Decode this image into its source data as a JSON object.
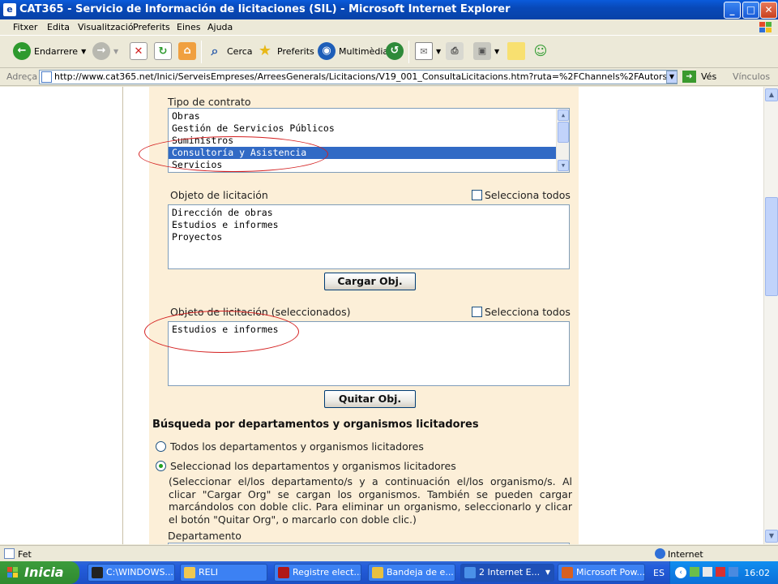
{
  "window": {
    "title": "CAT365 - Servicio de Información de licitaciones (SIL) - Microsoft Internet Explorer"
  },
  "menu": [
    "Fitxer",
    "Edita",
    "Visualització",
    "Preferits",
    "Eines",
    "Ajuda"
  ],
  "toolbar": {
    "back": "Endarrere",
    "search": "Cerca",
    "favorites": "Preferits",
    "media": "Multimèdia"
  },
  "address": {
    "label": "Adreça",
    "url": "http://www.cat365.net/Inici/ServeisEmpreses/ArreesGenerals/Licitacions/V19_001_ConsultaLicitacions.htm?ruta=%2FChannels%2FAutors%2FInici%2FServeisEmpres",
    "go": "Vés",
    "links": "Vínculos"
  },
  "form": {
    "contract_type_label": "Tipo de contrato",
    "contract_types": [
      {
        "label": "Obras",
        "selected": false
      },
      {
        "label": "Gestión de Servicios Públicos",
        "selected": false
      },
      {
        "label": "Suministros",
        "selected": false
      },
      {
        "label": "Consultoría y Asistencia",
        "selected": true
      },
      {
        "label": "Servicios",
        "selected": false
      }
    ],
    "object_label": "Objeto de licitación",
    "select_all": "Selecciona todos",
    "objects": [
      "Dirección de obras",
      "Estudios e informes",
      "Proyectos"
    ],
    "load_button": "Cargar Obj.",
    "selected_label": "Objeto de licitación (seleccionados)",
    "selected_objects": [
      "Estudios e informes"
    ],
    "remove_button": "Quitar Obj.",
    "section_title": "Búsqueda por departamentos y organismos licitadores",
    "radio_all": "Todos los departamentos y organismos licitadores",
    "radio_select": "Seleccionad los departamentos y organismos licitadores",
    "radio_selected": "select",
    "instructions": "(Seleccionar el/los departamento/s y a continuación el/los organismo/s. Al clicar \"Cargar Org\" se cargan los organismos. También se pueden cargar marcándolos con doble clic. Para eliminar un organismo, seleccionarlo y clicar el botón \"Quitar Org\", o marcarlo con doble clic.)",
    "department_label": "Departamento"
  },
  "status": {
    "left": "Fet",
    "zone": "Internet"
  },
  "taskbar": {
    "start": "Inicia",
    "tasks": [
      "C:\\WINDOWS...",
      "RELI",
      "Registre elect...",
      "Bandeja de e...",
      "2 Internet E...",
      "Microsoft Pow..."
    ],
    "language": "ES",
    "clock": "16:02"
  },
  "colors": {
    "accent": "#316AC5",
    "form_bg": "#FCEFD8",
    "annotation": "#D42020"
  }
}
